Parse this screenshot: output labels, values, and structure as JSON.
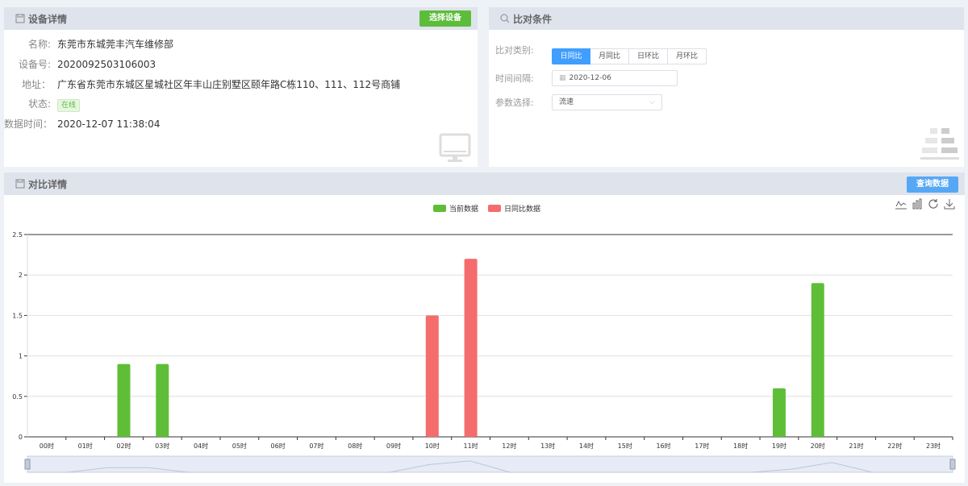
{
  "device_panel": {
    "title": "设备详情",
    "select_button": "选择设备",
    "rows": [
      {
        "label": "名称:",
        "value": "东莞市东城莞丰汽车维修部"
      },
      {
        "label": "设备号:",
        "value": "2020092503106003"
      },
      {
        "label": "地址：",
        "value": "广东省东莞市东城区星城社区年丰山庄别墅区颐年路C栋110、111、112号商铺"
      },
      {
        "label": "状态:",
        "value": "在线"
      },
      {
        "label": "数据时间：",
        "value": "2020-12-07 11:38:04"
      }
    ]
  },
  "compare_panel": {
    "title": "比对条件",
    "type_label": "比对类别:",
    "types": [
      "日同比",
      "月同比",
      "日环比",
      "月环比"
    ],
    "selected_type": "日同比",
    "interval_label": "时间间隔:",
    "date_value": "2020-12-06",
    "param_label": "参数选择:",
    "param_value": "流速"
  },
  "detail_panel": {
    "title": "对比详情",
    "query_button": "查询数据"
  },
  "colors": {
    "current": "#5fbe37",
    "compare": "#f56c6c",
    "accent": "#409eff"
  },
  "chart_data": {
    "type": "bar",
    "categories": [
      "00时",
      "01时",
      "02时",
      "03时",
      "04时",
      "05时",
      "06时",
      "07时",
      "08时",
      "09时",
      "10时",
      "11时",
      "12时",
      "13时",
      "14时",
      "15时",
      "16时",
      "17时",
      "18时",
      "19时",
      "20时",
      "21时",
      "22时",
      "23时"
    ],
    "series": [
      {
        "name": "当前数据",
        "values": [
          0,
          0,
          0.9,
          0.9,
          0,
          0,
          0,
          0,
          0,
          0,
          0,
          0,
          0,
          0,
          0,
          0,
          0,
          0,
          0,
          0.6,
          1.9,
          0,
          0,
          0
        ]
      },
      {
        "name": "日同比数据",
        "values": [
          0,
          0,
          0,
          0,
          0,
          0,
          0,
          0,
          0,
          0,
          1.5,
          2.2,
          0,
          0,
          0,
          0,
          0,
          0,
          0,
          0,
          0,
          0,
          0,
          0
        ]
      }
    ],
    "ylim": [
      0,
      2.5
    ],
    "yticks": [
      "0",
      "0.5",
      "1",
      "1.5",
      "2",
      "2.5"
    ],
    "grid": true,
    "legend": "top-center"
  }
}
